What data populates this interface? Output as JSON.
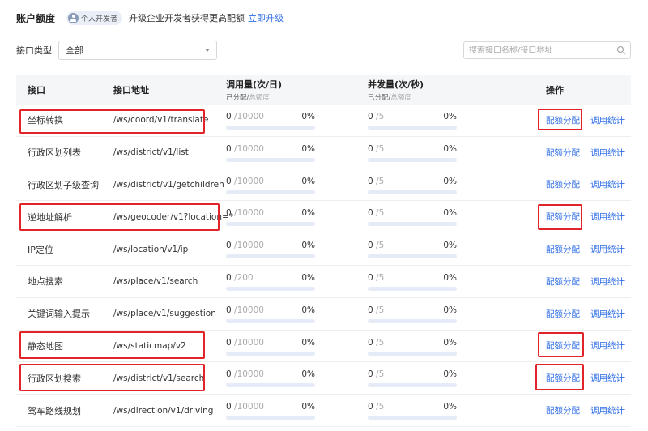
{
  "header": {
    "title": "账户额度",
    "badge": "个人开发者",
    "upgrade_text": "升级企业开发者获得更高配额",
    "upgrade_link": "立即升级"
  },
  "filter": {
    "label": "接口类型",
    "selected": "全部"
  },
  "search": {
    "placeholder": "搜索接口名称/接口地址"
  },
  "table": {
    "columns": {
      "name": "接口",
      "path": "接口地址",
      "calls": "调用量(次/日)",
      "concurrency": "并发量(次/秒)",
      "ops": "操作"
    },
    "sub_allocated": "已分配/",
    "sub_total": "总额度",
    "op_alloc": "配额分配",
    "op_stats": "调用统计",
    "rows": [
      {
        "name": "坐标转换",
        "path": "/ws/coord/v1/translate",
        "calls_alloc": "0",
        "calls_total": "/10000",
        "calls_pct": "0%",
        "calls_fill": 0,
        "conc_alloc": "0",
        "conc_total": "/5",
        "conc_pct": "0%",
        "conc_fill": 0
      },
      {
        "name": "行政区划列表",
        "path": "/ws/district/v1/list",
        "calls_alloc": "0",
        "calls_total": "/10000",
        "calls_pct": "0%",
        "calls_fill": 0,
        "conc_alloc": "0",
        "conc_total": "/5",
        "conc_pct": "0%",
        "conc_fill": 0
      },
      {
        "name": "行政区划子级查询",
        "path": "/ws/district/v1/getchildren",
        "calls_alloc": "0",
        "calls_total": "/10000",
        "calls_pct": "0%",
        "calls_fill": 0,
        "conc_alloc": "0",
        "conc_total": "/5",
        "conc_pct": "0%",
        "conc_fill": 0
      },
      {
        "name": "逆地址解析",
        "path": "/ws/geocoder/v1?location=*",
        "calls_alloc": "0",
        "calls_total": "/10000",
        "calls_pct": "0%",
        "calls_fill": 0,
        "conc_alloc": "0",
        "conc_total": "/5",
        "conc_pct": "0%",
        "conc_fill": 0
      },
      {
        "name": "IP定位",
        "path": "/ws/location/v1/ip",
        "calls_alloc": "0",
        "calls_total": "/10000",
        "calls_pct": "0%",
        "calls_fill": 0,
        "conc_alloc": "0",
        "conc_total": "/5",
        "conc_pct": "0%",
        "conc_fill": 0
      },
      {
        "name": "地点搜索",
        "path": "/ws/place/v1/search",
        "calls_alloc": "0",
        "calls_total": "/200",
        "calls_pct": "0%",
        "calls_fill": 0,
        "conc_alloc": "0",
        "conc_total": "/5",
        "conc_pct": "0%",
        "conc_fill": 0
      },
      {
        "name": "关键词输入提示",
        "path": "/ws/place/v1/suggestion",
        "calls_alloc": "0",
        "calls_total": "/10000",
        "calls_pct": "0%",
        "calls_fill": 0,
        "conc_alloc": "0",
        "conc_total": "/5",
        "conc_pct": "0%",
        "conc_fill": 0
      },
      {
        "name": "静态地图",
        "path": "/ws/staticmap/v2",
        "calls_alloc": "0",
        "calls_total": "/10000",
        "calls_pct": "0%",
        "calls_fill": 0,
        "conc_alloc": "0",
        "conc_total": "/5",
        "conc_pct": "0%",
        "conc_fill": 0
      },
      {
        "name": "行政区划搜索",
        "path": "/ws/district/v1/search",
        "calls_alloc": "0",
        "calls_total": "/10000",
        "calls_pct": "0%",
        "calls_fill": 0,
        "conc_alloc": "0",
        "conc_total": "/5",
        "conc_pct": "0%",
        "conc_fill": 0
      },
      {
        "name": "驾车路线规划",
        "path": "/ws/direction/v1/driving",
        "calls_alloc": "0",
        "calls_total": "/10000",
        "calls_pct": "0%",
        "calls_fill": 0,
        "conc_alloc": "0",
        "conc_total": "/5",
        "conc_pct": "0%",
        "conc_fill": 0
      }
    ]
  },
  "highlight_color": "#e0242a",
  "accent_color": "#2f6ee6"
}
